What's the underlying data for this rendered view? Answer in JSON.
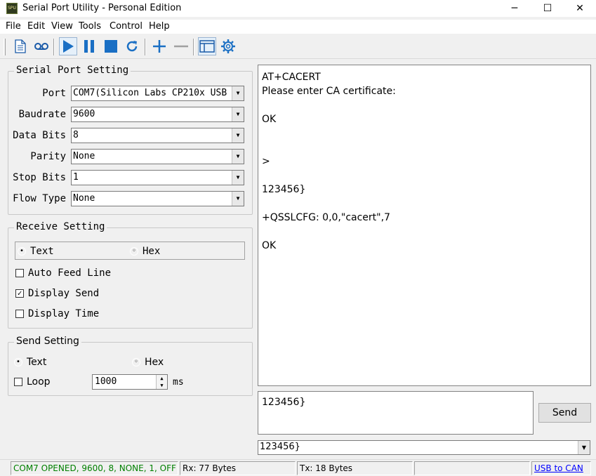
{
  "titlebar": {
    "app_icon_text": "SPU",
    "title": "Serial Port Utility - Personal Edition",
    "minimize_glyph": "─",
    "maximize_glyph": "☐",
    "close_glyph": "✕"
  },
  "menu": {
    "items": [
      {
        "label": "File"
      },
      {
        "label": "Edit"
      },
      {
        "label": "View"
      },
      {
        "label": "Tools"
      },
      {
        "label": "Control"
      },
      {
        "label": "Help"
      }
    ]
  },
  "toolbar": {
    "buttons": [
      {
        "name": "new-file-icon"
      },
      {
        "name": "record-icon"
      },
      {
        "name": "play-icon"
      },
      {
        "name": "pause-icon"
      },
      {
        "name": "stop-icon"
      },
      {
        "name": "refresh-icon"
      },
      {
        "name": "plus-icon"
      },
      {
        "name": "minus-icon"
      },
      {
        "name": "window-icon"
      },
      {
        "name": "gear-icon"
      }
    ],
    "accent": "#1a6fc4"
  },
  "serial_port_setting": {
    "title": "Serial Port Setting",
    "fields": [
      {
        "label": "Port",
        "value": "COM7(Silicon Labs CP210x USB"
      },
      {
        "label": "Baudrate",
        "value": "9600"
      },
      {
        "label": "Data Bits",
        "value": "8"
      },
      {
        "label": "Parity",
        "value": "None"
      },
      {
        "label": "Stop Bits",
        "value": "1"
      },
      {
        "label": "Flow Type",
        "value": "None"
      }
    ]
  },
  "receive_setting": {
    "title": "Receive Setting",
    "mode_options": [
      "Text",
      "Hex"
    ],
    "selected_mode": "Text",
    "checkboxes": [
      {
        "label": "Auto Feed Line",
        "checked": false
      },
      {
        "label": "Display Send",
        "checked": true
      },
      {
        "label": "Display Time",
        "checked": false
      }
    ]
  },
  "send_setting": {
    "title": "Send Setting",
    "mode_options": [
      "Text",
      "Hex"
    ],
    "selected_mode": "Text",
    "loop_label": "Loop",
    "loop_checked": false,
    "interval_value": "1000",
    "interval_unit": "ms"
  },
  "receive_area": {
    "lines": [
      "AT+CACERT",
      "Please enter CA certificate:",
      "",
      "OK",
      "",
      "",
      ">",
      "",
      "123456}",
      "",
      "+QSSLCFG: 0,0,\"cacert\",7",
      "",
      "OK"
    ]
  },
  "send_area": {
    "text": "123456}",
    "send_button": "Send",
    "history_value": "123456}"
  },
  "statusbar": {
    "port_status": "COM7 OPENED, 9600, 8, NONE, 1, OFF",
    "rx": "Rx: 77 Bytes",
    "tx": "Tx: 18 Bytes",
    "link": "USB to CAN",
    "status_color": "#008000",
    "link_color": "#0000ff"
  }
}
